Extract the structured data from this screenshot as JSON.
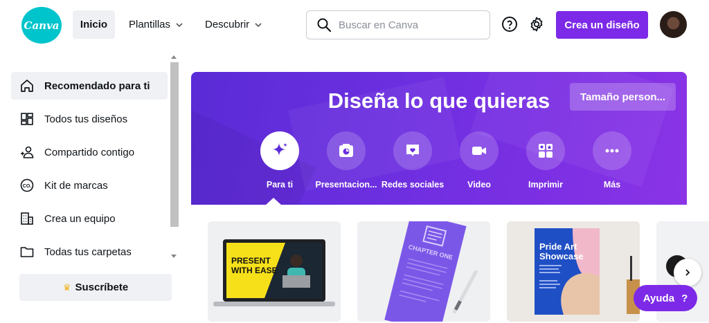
{
  "header": {
    "logo_text": "Canva",
    "nav_home": "Inicio",
    "nav_templates": "Plantillas",
    "nav_discover": "Descubrir",
    "search_placeholder": "Buscar en Canva",
    "create_button": "Crea un diseño",
    "icons": [
      "help-icon",
      "settings-icon"
    ]
  },
  "sidebar": {
    "items": [
      {
        "label": "Recomendado para ti",
        "icon": "home-icon",
        "active": true
      },
      {
        "label": "Todos tus diseños",
        "icon": "grid-icon",
        "active": false
      },
      {
        "label": "Compartido contigo",
        "icon": "people-icon",
        "active": false
      },
      {
        "label": "Kit de marcas",
        "icon": "brand-kit-icon",
        "active": false
      },
      {
        "label": "Crea un equipo",
        "icon": "building-icon",
        "active": false
      },
      {
        "label": "Todas tus carpetas",
        "icon": "folder-icon",
        "active": false
      }
    ],
    "subscribe_label": "Suscríbete"
  },
  "hero": {
    "title": "Diseña lo que quieras",
    "custom_size_button": "Tamaño person...",
    "categories": [
      {
        "label": "Para ti",
        "icon": "sparkle-icon",
        "active": true
      },
      {
        "label": "Presentacion...",
        "icon": "presentation-icon",
        "active": false
      },
      {
        "label": "Redes sociales",
        "icon": "heart-icon",
        "active": false
      },
      {
        "label": "Video",
        "icon": "video-icon",
        "active": false
      },
      {
        "label": "Imprimir",
        "icon": "print-icon",
        "active": false
      },
      {
        "label": "Más",
        "icon": "more-icon",
        "active": false
      }
    ]
  },
  "templates": [
    {
      "name": "presentation-template",
      "text": "PRESENT WITH EASE"
    },
    {
      "name": "document-template",
      "text": "CHAPTER ONE"
    },
    {
      "name": "poster-template",
      "text": "Pride Art Showcase"
    }
  ],
  "help_button": "Ayuda",
  "help_mark": "?",
  "colors": {
    "brand": "#7d2ae8",
    "logo": "#00c4cc",
    "hero_bg": "#6c2fe0"
  }
}
